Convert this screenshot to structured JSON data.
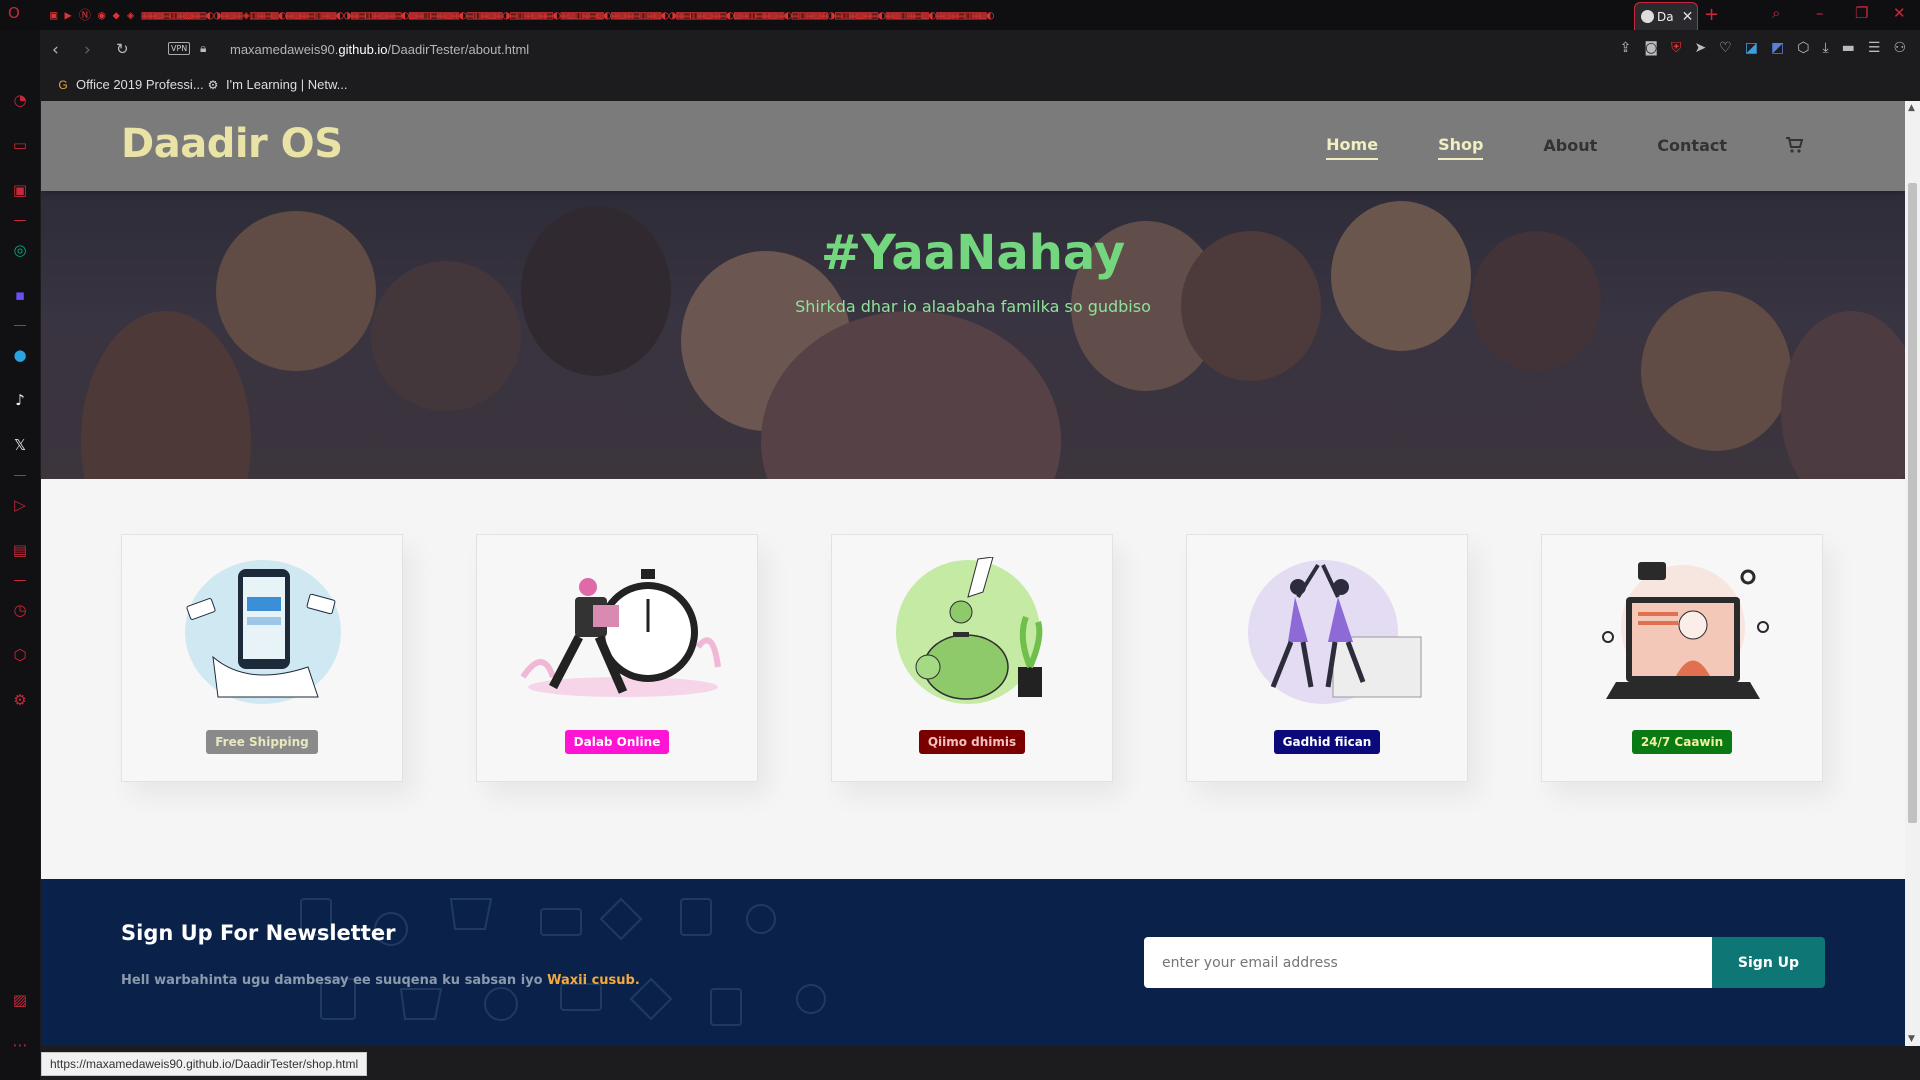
{
  "browser": {
    "active_tab_title": "Da",
    "url_prefix": "maxamedaweis90.",
    "url_host": "github.io",
    "url_path": "/DaadirTester/about.html",
    "vpn_label": "VPN",
    "status_url": "https://maxamedaweis90.github.io/DaadirTester/shop.html"
  },
  "bookmarks": [
    {
      "icon": "office-icon",
      "label": "Office 2019 Professi..."
    },
    {
      "icon": "learning-icon",
      "label": "I'm Learning | Netw..."
    }
  ],
  "site": {
    "brand": "Daadir OS",
    "nav": [
      {
        "label": "Home",
        "active": true
      },
      {
        "label": "Shop",
        "active": true
      },
      {
        "label": "About",
        "active": false
      },
      {
        "label": "Contact",
        "active": false
      }
    ],
    "cart_icon": "cart-icon"
  },
  "hero": {
    "title": "#YaaNahay",
    "subtitle": "Shirkda dhar io alaabaha familka so gudbiso"
  },
  "features": [
    {
      "label": "Free Shipping",
      "bg": "#8a8a8a",
      "fg": "#e8e8c0",
      "icon": "payment-phone-illustration"
    },
    {
      "label": "Dalab Online",
      "bg": "#ff14d4",
      "fg": "#ffffff",
      "icon": "delivery-clock-illustration"
    },
    {
      "label": "Qiimo dhimis",
      "bg": "#7a0000",
      "fg": "#f2c0c0",
      "icon": "piggy-bank-illustration"
    },
    {
      "label": "Gadhid fiican",
      "bg": "#0a0a7a",
      "fg": "#ffffff",
      "icon": "high-five-illustration"
    },
    {
      "label": "24/7 Caawin",
      "bg": "#0a7a14",
      "fg": "#f0f0a0",
      "icon": "support-laptop-illustration"
    }
  ],
  "newsletter": {
    "title": "Sign Up For Newsletter",
    "text": "Hell warbahinta ugu dambesay ee suuqena ku sabsan iyo ",
    "highlight": "Waxii cusub.",
    "placeholder": "enter your email address",
    "button": "Sign Up"
  },
  "colors": {
    "accent_green": "#74d67f",
    "brand_yellow": "#e9e4a6",
    "newsletter_bg": "#0a2249",
    "signup_btn": "#0e7775",
    "opera_red": "#c9283a"
  }
}
